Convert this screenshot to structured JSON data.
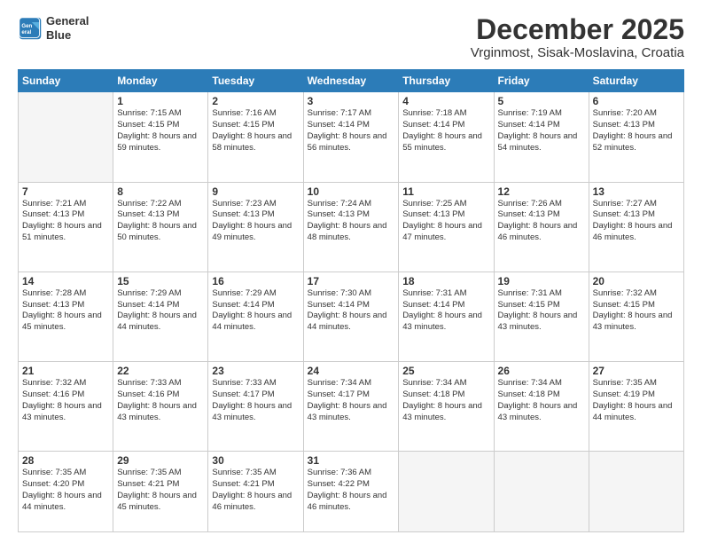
{
  "logo": {
    "line1": "General",
    "line2": "Blue"
  },
  "title": "December 2025",
  "subtitle": "Vrginmost, Sisak-Moslavina, Croatia",
  "weekdays": [
    "Sunday",
    "Monday",
    "Tuesday",
    "Wednesday",
    "Thursday",
    "Friday",
    "Saturday"
  ],
  "weeks": [
    [
      {
        "day": "",
        "sunrise": "",
        "sunset": "",
        "daylight": ""
      },
      {
        "day": "1",
        "sunrise": "Sunrise: 7:15 AM",
        "sunset": "Sunset: 4:15 PM",
        "daylight": "Daylight: 8 hours and 59 minutes."
      },
      {
        "day": "2",
        "sunrise": "Sunrise: 7:16 AM",
        "sunset": "Sunset: 4:15 PM",
        "daylight": "Daylight: 8 hours and 58 minutes."
      },
      {
        "day": "3",
        "sunrise": "Sunrise: 7:17 AM",
        "sunset": "Sunset: 4:14 PM",
        "daylight": "Daylight: 8 hours and 56 minutes."
      },
      {
        "day": "4",
        "sunrise": "Sunrise: 7:18 AM",
        "sunset": "Sunset: 4:14 PM",
        "daylight": "Daylight: 8 hours and 55 minutes."
      },
      {
        "day": "5",
        "sunrise": "Sunrise: 7:19 AM",
        "sunset": "Sunset: 4:14 PM",
        "daylight": "Daylight: 8 hours and 54 minutes."
      },
      {
        "day": "6",
        "sunrise": "Sunrise: 7:20 AM",
        "sunset": "Sunset: 4:13 PM",
        "daylight": "Daylight: 8 hours and 52 minutes."
      }
    ],
    [
      {
        "day": "7",
        "sunrise": "Sunrise: 7:21 AM",
        "sunset": "Sunset: 4:13 PM",
        "daylight": "Daylight: 8 hours and 51 minutes."
      },
      {
        "day": "8",
        "sunrise": "Sunrise: 7:22 AM",
        "sunset": "Sunset: 4:13 PM",
        "daylight": "Daylight: 8 hours and 50 minutes."
      },
      {
        "day": "9",
        "sunrise": "Sunrise: 7:23 AM",
        "sunset": "Sunset: 4:13 PM",
        "daylight": "Daylight: 8 hours and 49 minutes."
      },
      {
        "day": "10",
        "sunrise": "Sunrise: 7:24 AM",
        "sunset": "Sunset: 4:13 PM",
        "daylight": "Daylight: 8 hours and 48 minutes."
      },
      {
        "day": "11",
        "sunrise": "Sunrise: 7:25 AM",
        "sunset": "Sunset: 4:13 PM",
        "daylight": "Daylight: 8 hours and 47 minutes."
      },
      {
        "day": "12",
        "sunrise": "Sunrise: 7:26 AM",
        "sunset": "Sunset: 4:13 PM",
        "daylight": "Daylight: 8 hours and 46 minutes."
      },
      {
        "day": "13",
        "sunrise": "Sunrise: 7:27 AM",
        "sunset": "Sunset: 4:13 PM",
        "daylight": "Daylight: 8 hours and 46 minutes."
      }
    ],
    [
      {
        "day": "14",
        "sunrise": "Sunrise: 7:28 AM",
        "sunset": "Sunset: 4:13 PM",
        "daylight": "Daylight: 8 hours and 45 minutes."
      },
      {
        "day": "15",
        "sunrise": "Sunrise: 7:29 AM",
        "sunset": "Sunset: 4:14 PM",
        "daylight": "Daylight: 8 hours and 44 minutes."
      },
      {
        "day": "16",
        "sunrise": "Sunrise: 7:29 AM",
        "sunset": "Sunset: 4:14 PM",
        "daylight": "Daylight: 8 hours and 44 minutes."
      },
      {
        "day": "17",
        "sunrise": "Sunrise: 7:30 AM",
        "sunset": "Sunset: 4:14 PM",
        "daylight": "Daylight: 8 hours and 44 minutes."
      },
      {
        "day": "18",
        "sunrise": "Sunrise: 7:31 AM",
        "sunset": "Sunset: 4:14 PM",
        "daylight": "Daylight: 8 hours and 43 minutes."
      },
      {
        "day": "19",
        "sunrise": "Sunrise: 7:31 AM",
        "sunset": "Sunset: 4:15 PM",
        "daylight": "Daylight: 8 hours and 43 minutes."
      },
      {
        "day": "20",
        "sunrise": "Sunrise: 7:32 AM",
        "sunset": "Sunset: 4:15 PM",
        "daylight": "Daylight: 8 hours and 43 minutes."
      }
    ],
    [
      {
        "day": "21",
        "sunrise": "Sunrise: 7:32 AM",
        "sunset": "Sunset: 4:16 PM",
        "daylight": "Daylight: 8 hours and 43 minutes."
      },
      {
        "day": "22",
        "sunrise": "Sunrise: 7:33 AM",
        "sunset": "Sunset: 4:16 PM",
        "daylight": "Daylight: 8 hours and 43 minutes."
      },
      {
        "day": "23",
        "sunrise": "Sunrise: 7:33 AM",
        "sunset": "Sunset: 4:17 PM",
        "daylight": "Daylight: 8 hours and 43 minutes."
      },
      {
        "day": "24",
        "sunrise": "Sunrise: 7:34 AM",
        "sunset": "Sunset: 4:17 PM",
        "daylight": "Daylight: 8 hours and 43 minutes."
      },
      {
        "day": "25",
        "sunrise": "Sunrise: 7:34 AM",
        "sunset": "Sunset: 4:18 PM",
        "daylight": "Daylight: 8 hours and 43 minutes."
      },
      {
        "day": "26",
        "sunrise": "Sunrise: 7:34 AM",
        "sunset": "Sunset: 4:18 PM",
        "daylight": "Daylight: 8 hours and 43 minutes."
      },
      {
        "day": "27",
        "sunrise": "Sunrise: 7:35 AM",
        "sunset": "Sunset: 4:19 PM",
        "daylight": "Daylight: 8 hours and 44 minutes."
      }
    ],
    [
      {
        "day": "28",
        "sunrise": "Sunrise: 7:35 AM",
        "sunset": "Sunset: 4:20 PM",
        "daylight": "Daylight: 8 hours and 44 minutes."
      },
      {
        "day": "29",
        "sunrise": "Sunrise: 7:35 AM",
        "sunset": "Sunset: 4:21 PM",
        "daylight": "Daylight: 8 hours and 45 minutes."
      },
      {
        "day": "30",
        "sunrise": "Sunrise: 7:35 AM",
        "sunset": "Sunset: 4:21 PM",
        "daylight": "Daylight: 8 hours and 46 minutes."
      },
      {
        "day": "31",
        "sunrise": "Sunrise: 7:36 AM",
        "sunset": "Sunset: 4:22 PM",
        "daylight": "Daylight: 8 hours and 46 minutes."
      },
      {
        "day": "",
        "sunrise": "",
        "sunset": "",
        "daylight": ""
      },
      {
        "day": "",
        "sunrise": "",
        "sunset": "",
        "daylight": ""
      },
      {
        "day": "",
        "sunrise": "",
        "sunset": "",
        "daylight": ""
      }
    ]
  ]
}
